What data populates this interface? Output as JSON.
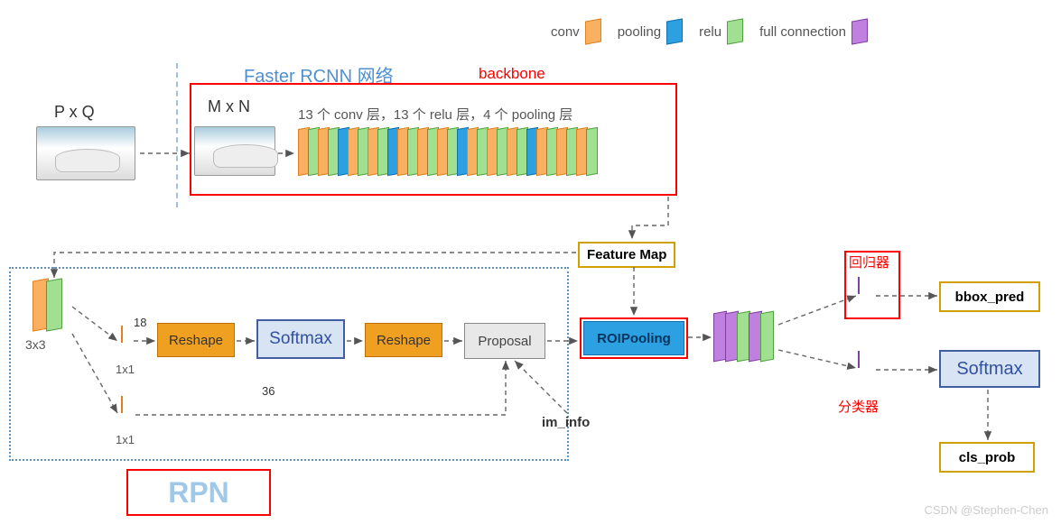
{
  "legend": {
    "conv": "conv",
    "pooling": "pooling",
    "relu": "relu",
    "fc": "full connection"
  },
  "title": {
    "net": "Faster RCNN 网络",
    "backbone": "backbone"
  },
  "input": {
    "pq": "P x Q",
    "mn": "M x N",
    "layers_desc": "13 个 conv 层，13 个 relu 层，4 个 pooling 层"
  },
  "feature_map": "Feature Map",
  "rpn": {
    "label": "RPN",
    "k33": "3x3",
    "k1a": "1x1",
    "k1b": "1x1",
    "n18": "18",
    "n36": "36",
    "reshape1": "Reshape",
    "softmax": "Softmax",
    "reshape2": "Reshape",
    "proposal": "Proposal",
    "im_info": "im_info"
  },
  "head": {
    "roipool": "ROIPooling",
    "regressor": "回归器",
    "classifier": "分类器",
    "bbox_pred": "bbox_pred",
    "softmax": "Softmax",
    "cls_prob": "cls_prob"
  },
  "watermark": "CSDN @Stephen-Chen",
  "chart_data": {
    "type": "diagram",
    "title": "Faster RCNN 网络",
    "legend": [
      {
        "name": "conv",
        "color": "#f9b060"
      },
      {
        "name": "pooling",
        "color": "#2ca0e0"
      },
      {
        "name": "relu",
        "color": "#a0e090"
      },
      {
        "name": "full connection",
        "color": "#c080e0"
      }
    ],
    "backbone": {
      "conv_layers": 13,
      "relu_layers": 13,
      "pooling_layers": 4,
      "input_resize": "P x Q → M x N"
    },
    "nodes": [
      {
        "id": "input_pq",
        "label": "P x Q"
      },
      {
        "id": "input_mn",
        "label": "M x N"
      },
      {
        "id": "backbone",
        "label": "backbone (13 conv,13 relu,4 pooling)"
      },
      {
        "id": "feature_map",
        "label": "Feature Map"
      },
      {
        "id": "rpn_3x3",
        "label": "3x3 conv+relu"
      },
      {
        "id": "rpn_1x1_cls",
        "label": "1x1 conv (18)"
      },
      {
        "id": "rpn_reshape1",
        "label": "Reshape"
      },
      {
        "id": "rpn_softmax",
        "label": "Softmax"
      },
      {
        "id": "rpn_reshape2",
        "label": "Reshape"
      },
      {
        "id": "rpn_1x1_reg",
        "label": "1x1 conv (36)"
      },
      {
        "id": "proposal",
        "label": "Proposal"
      },
      {
        "id": "im_info",
        "label": "im_info"
      },
      {
        "id": "roipool",
        "label": "ROIPooling"
      },
      {
        "id": "fc",
        "label": "fc layers"
      },
      {
        "id": "regressor_fc",
        "label": "回归器 fc"
      },
      {
        "id": "bbox_pred",
        "label": "bbox_pred"
      },
      {
        "id": "classifier_fc",
        "label": "分类器 fc"
      },
      {
        "id": "softmax_cls",
        "label": "Softmax"
      },
      {
        "id": "cls_prob",
        "label": "cls_prob"
      }
    ],
    "edges": [
      [
        "input_pq",
        "input_mn"
      ],
      [
        "input_mn",
        "backbone"
      ],
      [
        "backbone",
        "feature_map"
      ],
      [
        "feature_map",
        "rpn_3x3"
      ],
      [
        "rpn_3x3",
        "rpn_1x1_cls"
      ],
      [
        "rpn_1x1_cls",
        "rpn_reshape1"
      ],
      [
        "rpn_reshape1",
        "rpn_softmax"
      ],
      [
        "rpn_softmax",
        "rpn_reshape2"
      ],
      [
        "rpn_reshape2",
        "proposal"
      ],
      [
        "rpn_3x3",
        "rpn_1x1_reg"
      ],
      [
        "rpn_1x1_reg",
        "proposal"
      ],
      [
        "im_info",
        "proposal"
      ],
      [
        "feature_map",
        "roipool"
      ],
      [
        "proposal",
        "roipool"
      ],
      [
        "roipool",
        "fc"
      ],
      [
        "fc",
        "regressor_fc"
      ],
      [
        "regressor_fc",
        "bbox_pred"
      ],
      [
        "fc",
        "classifier_fc"
      ],
      [
        "classifier_fc",
        "softmax_cls"
      ],
      [
        "softmax_cls",
        "cls_prob"
      ]
    ]
  }
}
